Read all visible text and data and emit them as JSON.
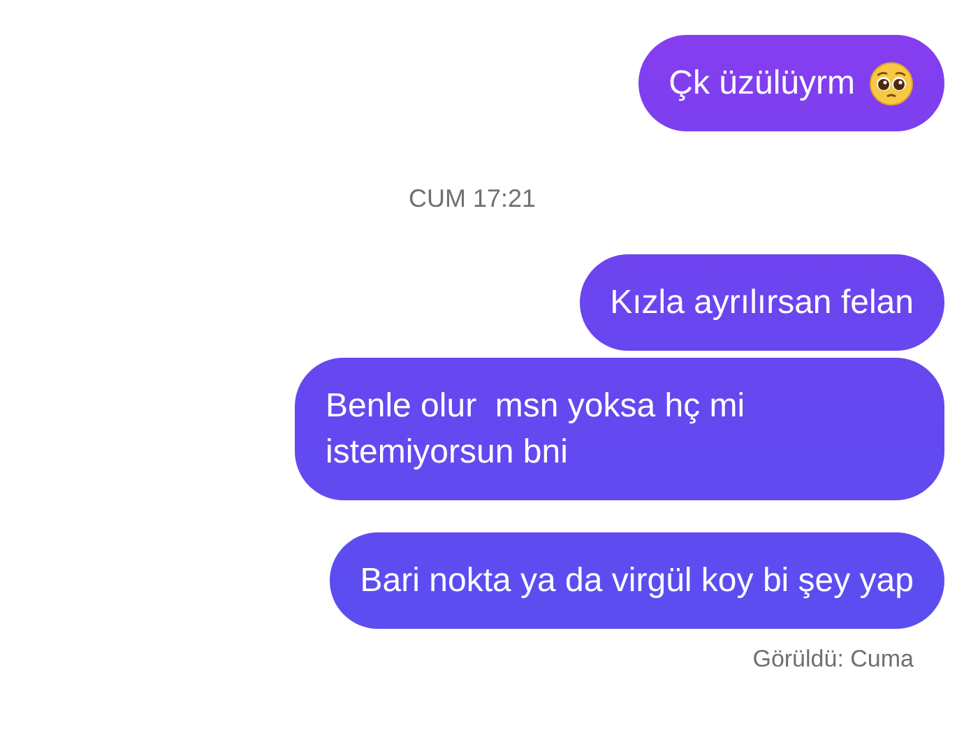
{
  "messages": [
    {
      "kind": "sent",
      "text": "Çk üzülüyrm",
      "emoji": true
    },
    {
      "kind": "timestamp",
      "text": "CUM 17:21"
    },
    {
      "kind": "sent",
      "text": "Kızla ayrılırsan felan",
      "emoji": false
    },
    {
      "kind": "sent",
      "text": "Benle olur  msn yoksa hç mi istemiyorsun bni",
      "emoji": false
    },
    {
      "kind": "sent",
      "text": "Bari nokta ya da virgül koy bi şey yap",
      "emoji": false
    }
  ],
  "seen_status": "Görüldü: Cuma"
}
